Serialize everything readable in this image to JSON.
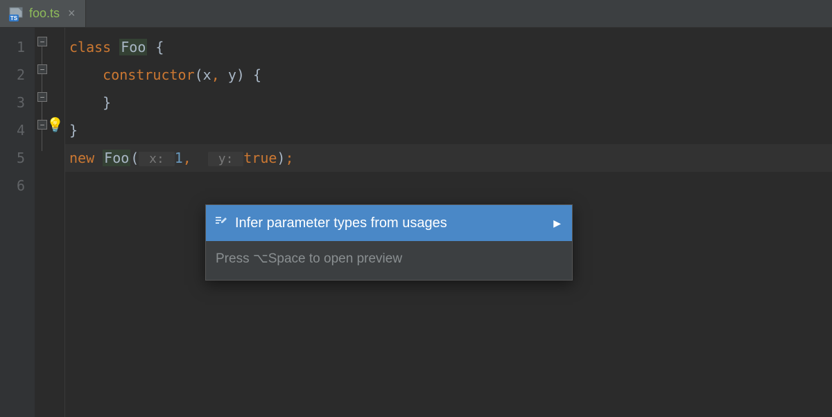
{
  "tab": {
    "filename": "foo.ts",
    "icon": "ts-file-icon"
  },
  "gutter": {
    "lines": [
      "1",
      "2",
      "3",
      "4",
      "5",
      "6"
    ]
  },
  "code": {
    "line1": {
      "kw": "class",
      "name": "Foo",
      "open": " {"
    },
    "line2": {
      "indent": "    ",
      "ctor": "constructor",
      "params_open": "(",
      "p1": "x",
      "comma": ", ",
      "p2": "y",
      "params_close": ")",
      "open": " {"
    },
    "line3": {
      "indent": "    ",
      "close": "}"
    },
    "line4": {
      "close": "}"
    },
    "line5": {
      "kw": "new",
      "sp": " ",
      "name": "Foo",
      "open": "(",
      "hint1": " x: ",
      "val1": "1",
      "comma": ", ",
      "hint2": " y: ",
      "val2": "true",
      "close": ")",
      "semi": ";"
    }
  },
  "intention": {
    "action": "Infer parameter types from usages",
    "footer": "Press ⌥Space to open preview"
  },
  "colors": {
    "bg": "#2b2b2b",
    "gutter": "#313335",
    "selection": "#4a88c7",
    "keyword": "#cc7832",
    "number": "#6897bb",
    "text": "#a9b7c6"
  }
}
